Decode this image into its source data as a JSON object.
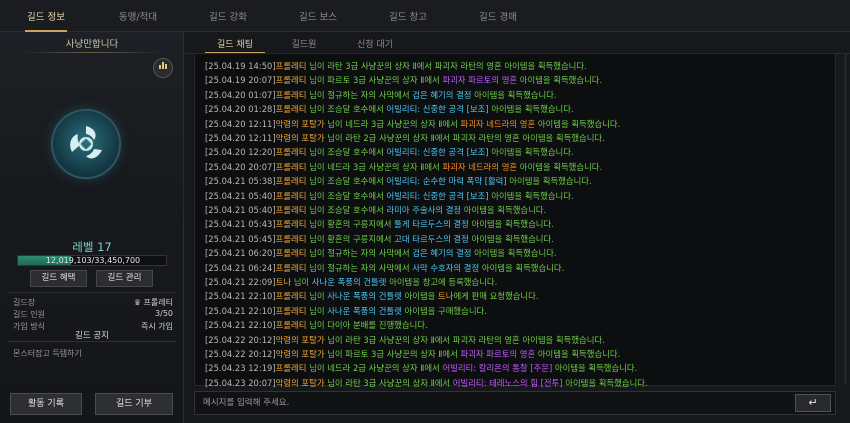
{
  "top_tabs": [
    "길드 정보",
    "동맹/적대",
    "길드 강화",
    "길드 보스",
    "길드 창고",
    "길드 경매"
  ],
  "left_panel": {
    "guild_name": "사냥만합니다",
    "stats_icon": "bar-chart-icon",
    "emblem_icon": "dragon-emblem-icon",
    "level": "레벨 17",
    "exp_text": "12,019,103/33,450,700",
    "exp_progress": 0.359,
    "benefit_button": "길드 혜택",
    "manage_button": "길드 관리",
    "info": [
      {
        "label": "길드장",
        "value": "프롤레티"
      },
      {
        "label": "길드 인원",
        "value": "3/50"
      },
      {
        "label": "가입 방식",
        "value": "즉시 가입"
      }
    ],
    "leader_icon": "crown-icon",
    "notice_title": "길드 공지",
    "notice_text": "몬스터잡고 득템하기",
    "activity_button": "활동 기록",
    "donate_button": "길드 기부"
  },
  "sub_tabs": [
    "길드 채팅",
    "길드원",
    "신청 대기"
  ],
  "chat": [
    [
      [
        "ts",
        "[25.04.19 14:50]"
      ],
      [
        "nm",
        "프롤레티"
      ],
      [
        "tx",
        " 님이 라탄 3급 사냥꾼의 상자 Ⅱ에서 파괴자 라탄의 영혼 아이템을 획득했습니다."
      ]
    ],
    [
      [
        "ts",
        "[25.04.19 20:07]"
      ],
      [
        "nm",
        "프롤레티"
      ],
      [
        "tx",
        " 님이 파르토 3급 사냥꾼의 상자 Ⅱ에서 "
      ],
      [
        "ip",
        "파괴자 파르토의 영혼"
      ],
      [
        "tx",
        " 아이템을 획득했습니다."
      ]
    ],
    [
      [
        "ts",
        "[25.04.20 01:07]"
      ],
      [
        "nm",
        "프롤레티"
      ],
      [
        "tx",
        " 님이 절규하는 자의 사막에서 "
      ],
      [
        "it",
        "검은 혜기의 결정"
      ],
      [
        "tx",
        " 아이템을 획득했습니다."
      ]
    ],
    [
      [
        "ts",
        "[25.04.20 01:28]"
      ],
      [
        "nm",
        "프롤레티"
      ],
      [
        "tx",
        " 님이 조승달 호수에서 "
      ],
      [
        "it",
        "어빌리티: 신중한 공격 [보조]"
      ],
      [
        "tx",
        " 아이템을 획득했습니다."
      ]
    ],
    [
      [
        "ts",
        "[25.04.20 12:11]"
      ],
      [
        "nm",
        "악령의 포탈가"
      ],
      [
        "tx",
        " 님이 네드라 3급 사냥꾼의 상자 Ⅱ에서 "
      ],
      [
        "io",
        "파괴자 네드라의 영혼"
      ],
      [
        "tx",
        " 아이템을 획득했습니다."
      ]
    ],
    [
      [
        "ts",
        "[25.04.20 12:11]"
      ],
      [
        "nm",
        "악령의 포탈가"
      ],
      [
        "tx",
        " 님이 라탄 2급 사냥꾼의 상자 Ⅱ에서 파괴자 라탄의 영혼 아이템을 획득했습니다."
      ]
    ],
    [
      [
        "ts",
        "[25.04.20 12:20]"
      ],
      [
        "nm",
        "프롤레티"
      ],
      [
        "tx",
        " 님이 조승달 호수에서 "
      ],
      [
        "it",
        "어빌리티: 신중한 공격 [보조]"
      ],
      [
        "tx",
        " 아이템을 획득했습니다."
      ]
    ],
    [
      [
        "ts",
        "[25.04.20 20:07]"
      ],
      [
        "nm",
        "프롤레티"
      ],
      [
        "tx",
        " 님이 네드라 3급 사냥꾼의 상자 Ⅱ에서 "
      ],
      [
        "io",
        "파괴자 네드라의 영혼"
      ],
      [
        "tx",
        " 아이템을 획득했습니다."
      ]
    ],
    [
      [
        "ts",
        "[25.04.21 05:38]"
      ],
      [
        "nm",
        "프롤레티"
      ],
      [
        "tx",
        " 님이 조승달 호수에서 "
      ],
      [
        "it",
        "어빌리티: 순수한 마력 폭약 [활력]"
      ],
      [
        "tx",
        " 아이템을 획득했습니다."
      ]
    ],
    [
      [
        "ts",
        "[25.04.21 05:40]"
      ],
      [
        "nm",
        "프롤레티"
      ],
      [
        "tx",
        " 님이 조승달 호수에서 "
      ],
      [
        "it",
        "어빌리티: 신중한 공격 [보조]"
      ],
      [
        "tx",
        " 아이템을 획득했습니다."
      ]
    ],
    [
      [
        "ts",
        "[25.04.21 05:40]"
      ],
      [
        "nm",
        "프롤레티"
      ],
      [
        "tx",
        " 님이 조승달 호수에서 "
      ],
      [
        "it",
        "라미아 주술사의 결정"
      ],
      [
        "tx",
        " 아이템을 획득했습니다."
      ]
    ],
    [
      [
        "ts",
        "[25.04.21 05:43]"
      ],
      [
        "nm",
        "프롤레티"
      ],
      [
        "tx",
        " 님이 황혼의 구릉지에서 "
      ],
      [
        "it",
        "툴게 타르두스의 결정"
      ],
      [
        "tx",
        " 아이템을 획득했습니다."
      ]
    ],
    [
      [
        "ts",
        "[25.04.21 05:45]"
      ],
      [
        "nm",
        "프롤레티"
      ],
      [
        "tx",
        " 님이 황혼의 구릉지에서 "
      ],
      [
        "it",
        "고대 타르두스의 결정"
      ],
      [
        "tx",
        " 아이템을 획득했습니다."
      ]
    ],
    [
      [
        "ts",
        "[25.04.21 06:20]"
      ],
      [
        "nm",
        "프롤레티"
      ],
      [
        "tx",
        " 님이 절규하는 자의 사막에서 "
      ],
      [
        "it",
        "검은 혜기의 결정"
      ],
      [
        "tx",
        " 아이템을 획득했습니다."
      ]
    ],
    [
      [
        "ts",
        "[25.04.21 06:24]"
      ],
      [
        "nm",
        "프롤레티"
      ],
      [
        "tx",
        " 님이 절규하는 자의 사막에서 "
      ],
      [
        "it",
        "사막 수호자의 결정"
      ],
      [
        "tx",
        " 아이템을 획득했습니다."
      ]
    ],
    [
      [
        "ts",
        "[25.04.21 22:09]"
      ],
      [
        "nm",
        "트나"
      ],
      [
        "tx",
        " 님이 "
      ],
      [
        "it",
        "사나운 폭풍의 건틀렛"
      ],
      [
        "tx",
        " 아이템을 창고에 등록했습니다."
      ]
    ],
    [
      [
        "ts",
        "[25.04.21 22:10]"
      ],
      [
        "nm",
        "프롤레티"
      ],
      [
        "tx",
        " 님이 "
      ],
      [
        "it",
        "사나운 폭풍의 건틀렛"
      ],
      [
        "tx",
        " 아이템을 "
      ],
      [
        "nm",
        "트나"
      ],
      [
        "tx",
        "에게 판매 요청했습니다."
      ]
    ],
    [
      [
        "ts",
        "[25.04.21 22:10]"
      ],
      [
        "nm",
        "프롤레티"
      ],
      [
        "tx",
        " 님이 "
      ],
      [
        "it",
        "사나운 폭풍의 건틀렛"
      ],
      [
        "tx",
        " 아이템을 구매했습니다."
      ]
    ],
    [
      [
        "ts",
        "[25.04.21 22:10]"
      ],
      [
        "nm",
        "프롤레티"
      ],
      [
        "tx",
        " 님이 다이아 분배를 진행했습니다."
      ]
    ],
    [
      [
        "ts",
        "[25.04.22 20:12]"
      ],
      [
        "nm",
        "악령의 포탈가"
      ],
      [
        "tx",
        " 님이 라탄 3급 사냥꾼의 상자 Ⅱ에서 파괴자 라탄의 영혼 아이템을 획득했습니다."
      ]
    ],
    [
      [
        "ts",
        "[25.04.22 20:12]"
      ],
      [
        "nm",
        "악령의 포탈가"
      ],
      [
        "tx",
        " 님이 파르토 3급 사냥꾼의 상자 Ⅱ에서 "
      ],
      [
        "ip",
        "파괴자 파르토의 영혼"
      ],
      [
        "tx",
        " 아이템을 획득했습니다."
      ]
    ],
    [
      [
        "ts",
        "[25.04.23 12:19]"
      ],
      [
        "nm",
        "프롤레티"
      ],
      [
        "tx",
        " 님이 네드라 2급 사냥꾼의 상자 Ⅱ에서 "
      ],
      [
        "ip",
        "어빌리티: 칼리온의 통찰 [주문]"
      ],
      [
        "tx",
        " 아이템을 획득했습니다."
      ]
    ],
    [
      [
        "ts",
        "[25.04.23 20:07]"
      ],
      [
        "nm",
        "악령의 포탈가"
      ],
      [
        "tx",
        " 님이 라탄 3급 사냥꾼의 상자 Ⅱ에서 "
      ],
      [
        "ip",
        "어빌리티: 테레노스의 힘 [전투]"
      ],
      [
        "tx",
        " 아이템을 획득했습니다."
      ]
    ]
  ],
  "chat_input": {
    "placeholder": "메시지를 입력해 주세요.",
    "enter_icon": "enter-return-icon",
    "enter_glyph": "↵"
  }
}
